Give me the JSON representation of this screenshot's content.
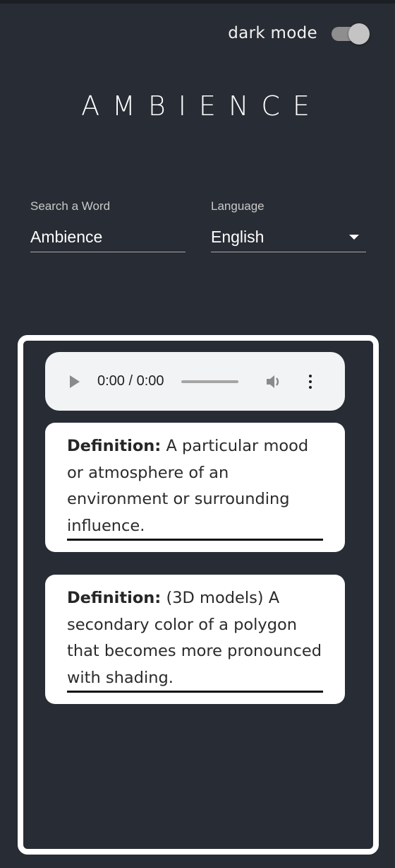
{
  "header": {
    "dark_mode_label": "dark mode",
    "dark_mode_on": true
  },
  "app": {
    "title": "AMBIENCE"
  },
  "search": {
    "label": "Search a Word",
    "value": "Ambience"
  },
  "language": {
    "label": "Language",
    "selected": "English"
  },
  "audio": {
    "time": "0:00 / 0:00",
    "progress": 0
  },
  "definitions": [
    {
      "label": "Definition:",
      "text": " A particular mood or atmosphere of an environment or surrounding influence."
    },
    {
      "label": "Definition:",
      "text": " (3D models) A secondary color of a polygon that becomes more pronounced with shading."
    }
  ],
  "colors": {
    "background": "#282c34",
    "card": "#ffffff",
    "audio_bg": "#f1f3f4",
    "toggle_thumb": "#c4c4c4"
  }
}
